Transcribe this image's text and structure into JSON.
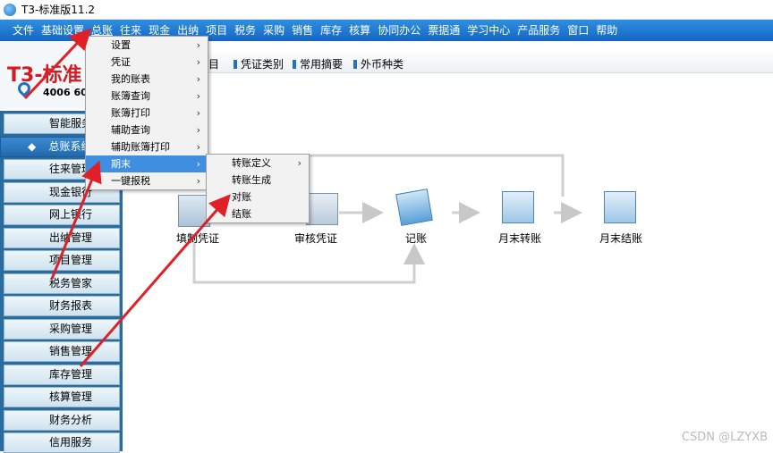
{
  "window": {
    "title": "T3-标准版11.2"
  },
  "menubar": [
    "文件",
    "基础设置",
    "总账",
    "往来",
    "现金",
    "出纳",
    "项目",
    "税务",
    "采购",
    "销售",
    "库存",
    "核算",
    "协同办公",
    "票据通",
    "学习中心",
    "产品服务",
    "窗口",
    "帮助"
  ],
  "logo": {
    "brand": "T3-标准",
    "phone": "4006 60"
  },
  "shortcuts": [
    "目",
    "凭证类别",
    "常用摘要",
    "外币种类"
  ],
  "leftnav": [
    "智能服务",
    "总账系统",
    "往来管理",
    "现金银行",
    "网上银行",
    "出纳管理",
    "项目管理",
    "税务管家",
    "财务报表",
    "采购管理",
    "销售管理",
    "库存管理",
    "核算管理",
    "财务分析",
    "信用服务"
  ],
  "leftnav_selected_bullet": "◆",
  "flow": {
    "nodes": [
      "填制凭证",
      "审核凭证",
      "记账",
      "月末转账",
      "月末结账"
    ]
  },
  "menu1": {
    "items": [
      {
        "label": "设置",
        "submenu": true
      },
      {
        "label": "凭证",
        "submenu": true
      },
      {
        "label": "我的账表",
        "submenu": true
      },
      {
        "label": "账簿查询",
        "submenu": true
      },
      {
        "label": "账簿打印",
        "submenu": true
      },
      {
        "label": "辅助查询",
        "submenu": true
      },
      {
        "label": "辅助账簿打印",
        "submenu": true
      },
      {
        "label": "期末",
        "submenu": true
      },
      {
        "label": "一键报税",
        "submenu": true
      }
    ],
    "highlighted": 7
  },
  "menu2": {
    "items": [
      {
        "label": "转账定义",
        "submenu": true
      },
      {
        "label": "转账生成",
        "submenu": false
      },
      {
        "label": "对账",
        "submenu": false
      },
      {
        "label": "结账",
        "submenu": false
      }
    ]
  },
  "submenu_arrow": "›",
  "watermark": "CSDN @LZYXB",
  "colors": {
    "menubar": "#1f7ad4",
    "nav_selected": "#2a78c0",
    "menu_highlight": "#3f8ee0",
    "annotation_arrow": "#e01f26"
  }
}
